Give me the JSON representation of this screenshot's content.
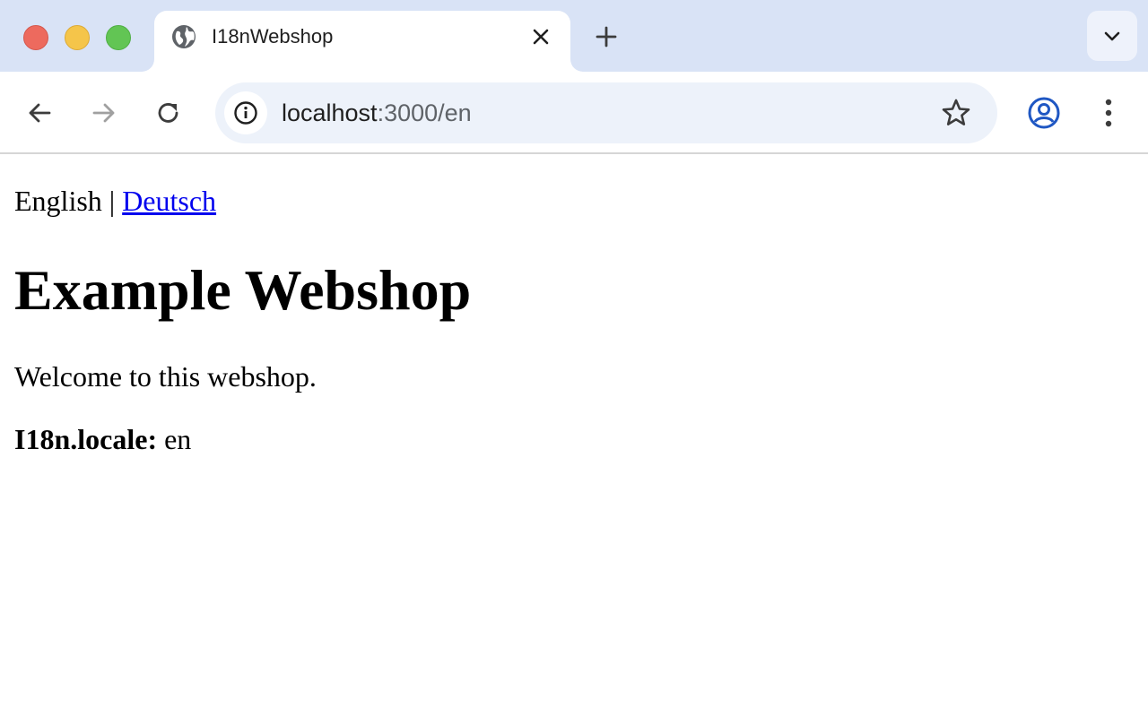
{
  "browser": {
    "tab": {
      "title": "I18nWebshop",
      "favicon": "globe-icon"
    },
    "url": {
      "host": "localhost",
      "path": ":3000/en"
    },
    "icons": {
      "back": "arrow-left-icon",
      "forward": "arrow-right-icon",
      "reload": "reload-icon",
      "site_info": "info-icon",
      "bookmark": "star-icon",
      "profile": "profile-icon",
      "menu": "kebab-menu-icon",
      "new_tab": "plus-icon",
      "tab_search": "chevron-down-icon"
    },
    "colors": {
      "tabstrip": "#d9e3f6",
      "omnibox": "#edf2fa",
      "profile_accent": "#1f57c3"
    }
  },
  "page": {
    "language_switch": {
      "current": "English",
      "separator": " | ",
      "other_link": "Deutsch"
    },
    "heading": "Example Webshop",
    "welcome": "Welcome to this webshop.",
    "locale": {
      "label": "I18n.locale:",
      "value": "en"
    },
    "link_color": "#0000ee"
  }
}
